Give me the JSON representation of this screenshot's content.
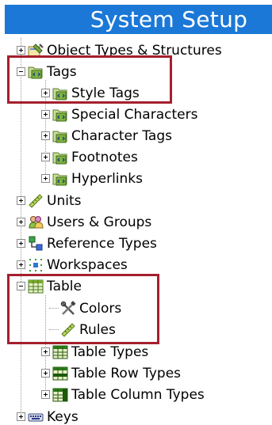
{
  "header": {
    "title": "System Setup"
  },
  "tree": {
    "items": [
      {
        "label": "Object Types & Structures",
        "icon": "object-types-icon",
        "toggle": "plus"
      },
      {
        "label": "Tags",
        "icon": "tags-folder-icon",
        "toggle": "minus"
      },
      {
        "label": "Style Tags",
        "icon": "tags-folder-icon",
        "toggle": "plus"
      },
      {
        "label": "Special Characters",
        "icon": "tags-folder-icon",
        "toggle": "plus"
      },
      {
        "label": "Character Tags",
        "icon": "tags-folder-icon",
        "toggle": "plus"
      },
      {
        "label": "Footnotes",
        "icon": "tags-folder-icon",
        "toggle": "plus"
      },
      {
        "label": "Hyperlinks",
        "icon": "tags-folder-icon",
        "toggle": "plus"
      },
      {
        "label": "Units",
        "icon": "ruler-icon",
        "toggle": "plus"
      },
      {
        "label": "Users & Groups",
        "icon": "users-icon",
        "toggle": "plus"
      },
      {
        "label": "Reference Types",
        "icon": "reference-types-icon",
        "toggle": "plus"
      },
      {
        "label": "Workspaces",
        "icon": "workspaces-icon",
        "toggle": "plus"
      },
      {
        "label": "Table",
        "icon": "table-icon",
        "toggle": "minus"
      },
      {
        "label": "Colors",
        "icon": "tools-icon",
        "toggle": "none"
      },
      {
        "label": "Rules",
        "icon": "ruler-icon",
        "toggle": "none"
      },
      {
        "label": "Table Types",
        "icon": "table-types-icon",
        "toggle": "plus"
      },
      {
        "label": "Table Row Types",
        "icon": "table-row-types-icon",
        "toggle": "plus"
      },
      {
        "label": "Table Column Types",
        "icon": "table-column-types-icon",
        "toggle": "plus"
      },
      {
        "label": "Keys",
        "icon": "keys-icon",
        "toggle": "plus"
      }
    ]
  },
  "colors": {
    "header_bg": "#1b78d7",
    "highlight_border": "#a51f2d"
  }
}
